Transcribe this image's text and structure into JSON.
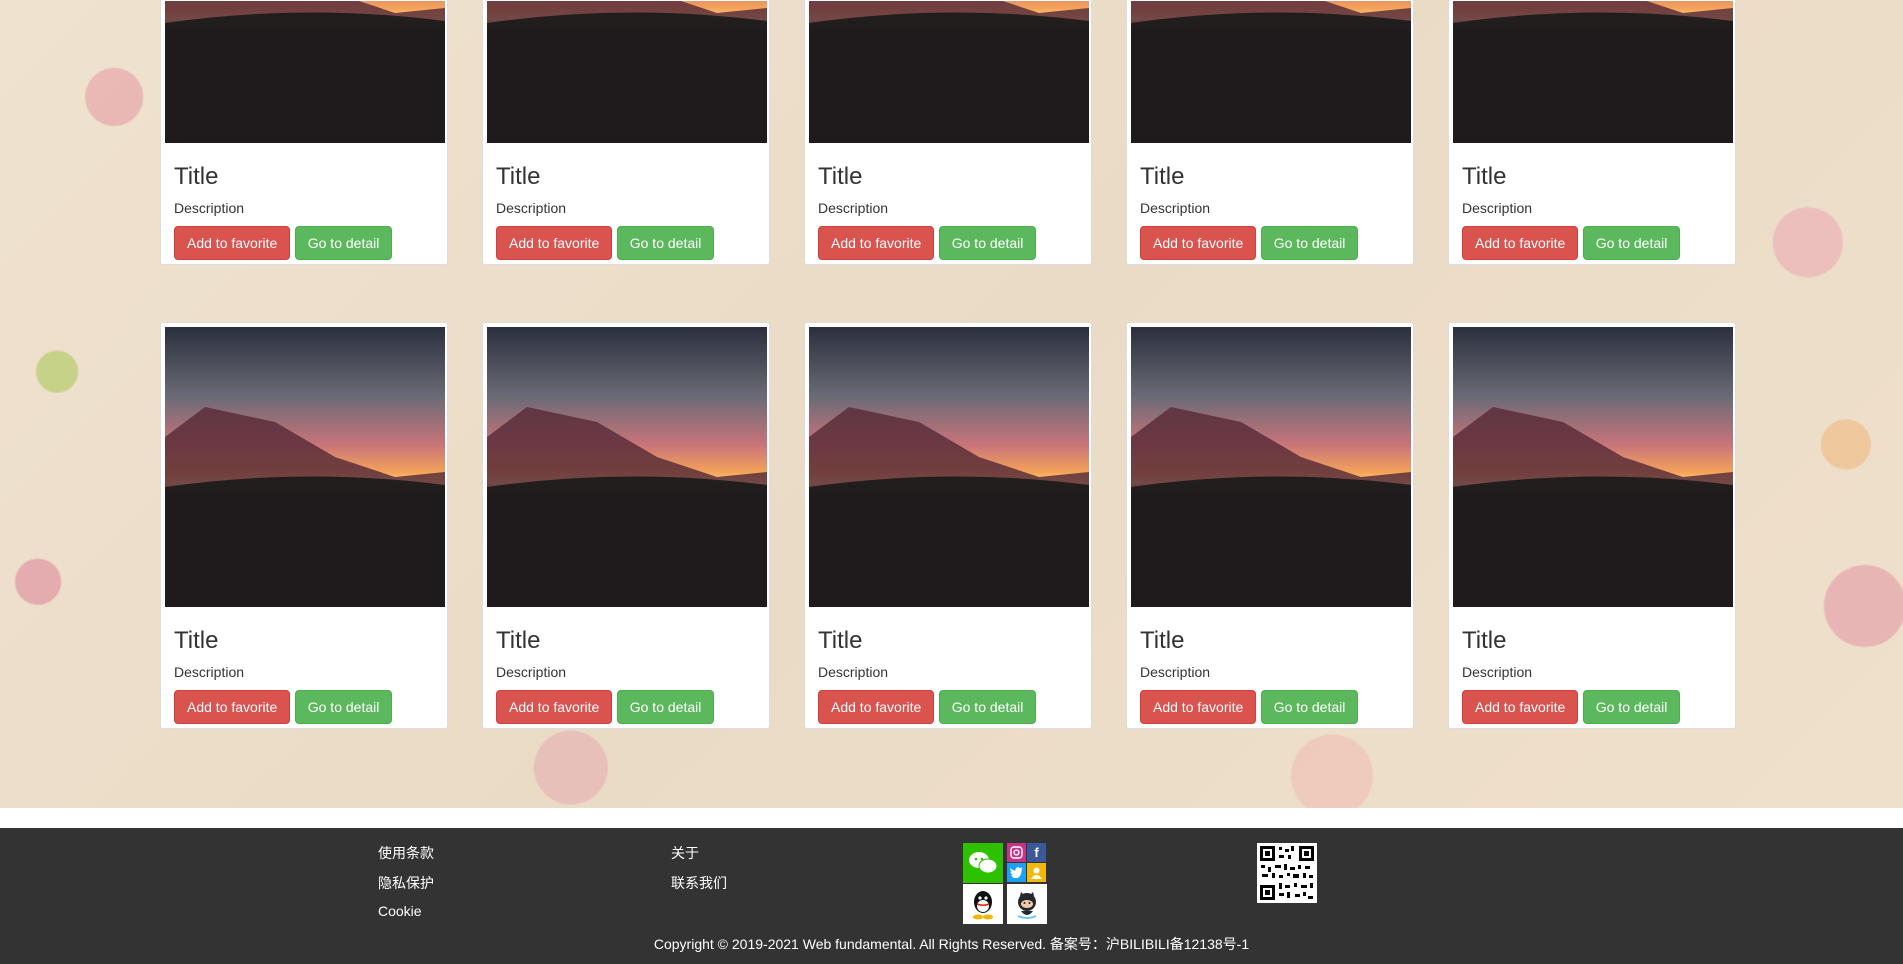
{
  "cards": [
    {
      "title": "Title",
      "description": "Description",
      "favorite_label": "Add to favorite",
      "detail_label": "Go to detail"
    },
    {
      "title": "Title",
      "description": "Description",
      "favorite_label": "Add to favorite",
      "detail_label": "Go to detail"
    },
    {
      "title": "Title",
      "description": "Description",
      "favorite_label": "Add to favorite",
      "detail_label": "Go to detail"
    },
    {
      "title": "Title",
      "description": "Description",
      "favorite_label": "Add to favorite",
      "detail_label": "Go to detail"
    },
    {
      "title": "Title",
      "description": "Description",
      "favorite_label": "Add to favorite",
      "detail_label": "Go to detail"
    },
    {
      "title": "Title",
      "description": "Description",
      "favorite_label": "Add to favorite",
      "detail_label": "Go to detail"
    },
    {
      "title": "Title",
      "description": "Description",
      "favorite_label": "Add to favorite",
      "detail_label": "Go to detail"
    },
    {
      "title": "Title",
      "description": "Description",
      "favorite_label": "Add to favorite",
      "detail_label": "Go to detail"
    },
    {
      "title": "Title",
      "description": "Description",
      "favorite_label": "Add to favorite",
      "detail_label": "Go to detail"
    },
    {
      "title": "Title",
      "description": "Description",
      "favorite_label": "Add to favorite",
      "detail_label": "Go to detail"
    }
  ],
  "footer": {
    "links_col1": [
      "使用条款",
      "隐私保护",
      "Cookie"
    ],
    "links_col2": [
      "关于",
      "联系我们"
    ],
    "social_icons": [
      "wechat-icon",
      "instagram-icon",
      "facebook-icon",
      "twitter-icon",
      "contact-icon",
      "qq-icon",
      "github-icon"
    ],
    "qr_icon": "qr-code-icon",
    "copyright": "Copyright © 2019-2021 Web fundamental. All Rights Reserved. 备案号：沪BILIBILI备12138号-1"
  },
  "colors": {
    "danger": "#d9534f",
    "success": "#5cb85c",
    "footer_bg": "#333333"
  }
}
